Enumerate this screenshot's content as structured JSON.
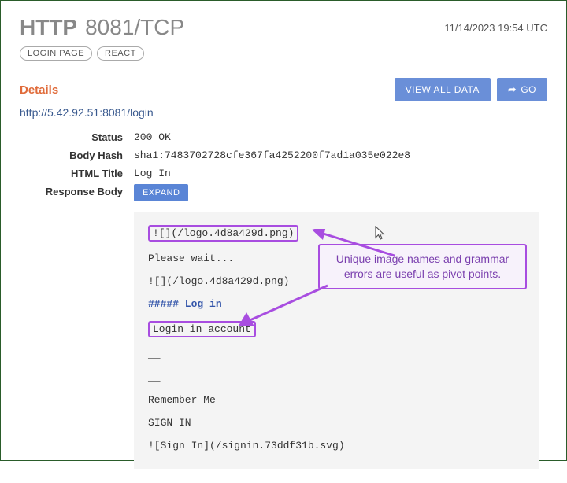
{
  "header": {
    "protocol": "HTTP",
    "port_proto": "8081/TCP",
    "timestamp": "11/14/2023 19:54 UTC"
  },
  "tags": [
    "LOGIN PAGE",
    "REACT"
  ],
  "section": {
    "title": "Details",
    "view_all": "VIEW ALL DATA",
    "go": "GO"
  },
  "url": "http://5.42.92.51:8081/login",
  "fields": {
    "status_label": "Status",
    "status_value": "200 OK",
    "bodyhash_label": "Body Hash",
    "bodyhash_value": "sha1:7483702728cfe367fa4252200f7ad1a035e022e8",
    "htmltitle_label": "HTML Title",
    "htmltitle_value": "Log In",
    "responsebody_label": "Response Body",
    "expand": "EXPAND"
  },
  "body": {
    "l1": "![](/logo.4d8a429d.png)",
    "l2": "Please wait...",
    "l3": "![](/logo.4d8a429d.png)",
    "l4": "##### Log in",
    "l5": "Login in account",
    "l6": "__",
    "l7": "__",
    "l8": "Remember Me",
    "l9": "SIGN IN",
    "l10": "![Sign In](/signin.73ddf31b.svg)"
  },
  "callout": "Unique image names and grammar errors are useful as pivot points."
}
